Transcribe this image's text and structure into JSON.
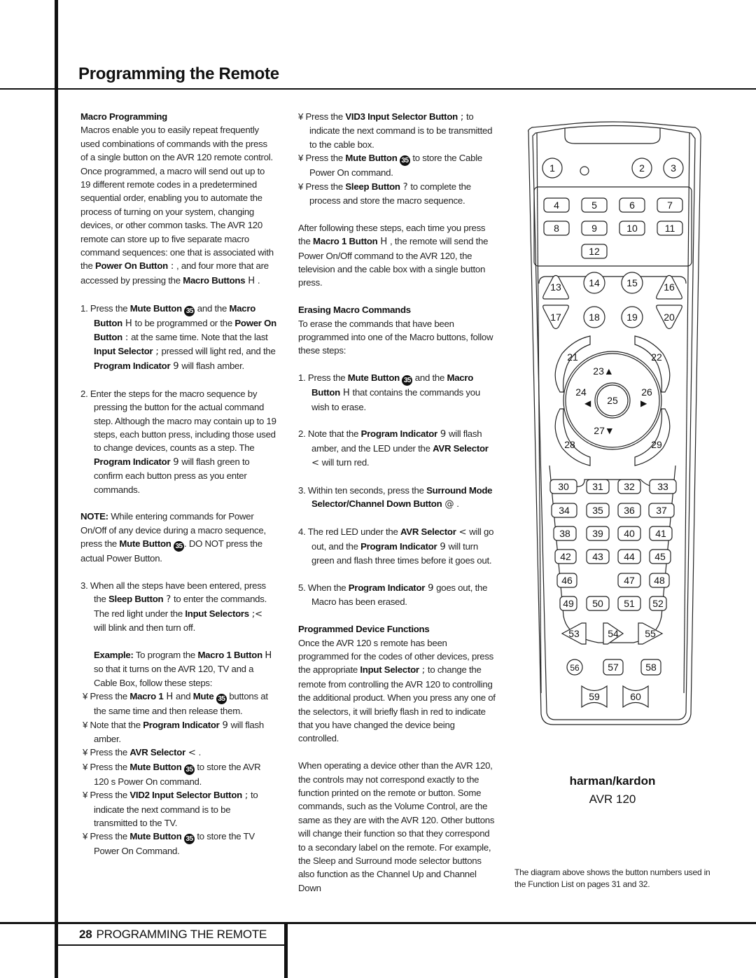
{
  "header": {
    "title": "Programming the Remote"
  },
  "footer": {
    "page_number": "28",
    "section": "PROGRAMMING THE REMOTE"
  },
  "column1": {
    "macro_heading": "Macro Programming",
    "intro_part1": "Macros enable you to easily repeat frequently used combinations of commands with the press of a single button on the AVR 120 remote control. Once programmed, a macro will send out up to 19 different remote codes in a predetermined sequential order, enabling you to automate the process of turning on your system, changing devices, or other common tasks. The AVR 120 remote can store up to five separate macro command sequences: one that is associated with the ",
    "intro_bold1": "Power On Button",
    "intro_sym1": " : ",
    "intro_part2": " , and four more that are accessed by pressing the ",
    "intro_bold2": "Macro Buttons",
    "intro_sym2": " H ",
    "intro_part3": " .",
    "step1": {
      "num": "1.",
      "t1": "Press the ",
      "b1": "Mute Button",
      "c1": "35",
      "t2": " and the ",
      "b2": "Macro Button",
      "s2": " H ",
      "t3": " to be programmed or the ",
      "b3": "Power On Button",
      "s3": " : ",
      "t4": " at the same time. Note that the last ",
      "b4": "Input Selector",
      "s4": " ; ",
      "t5": " pressed will light red, and the ",
      "b5": "Program Indicator",
      "s5": " 9 ",
      "t6": " will flash amber."
    },
    "step2": {
      "num": "2.",
      "t1": "Enter the steps for the macro sequence by pressing the button for the actual command step. Although the macro may contain up to 19 steps, each button press, including those used to change devices, counts as a step. The ",
      "b1": "Program Indicator",
      "s1": " 9 ",
      "t2": " will flash green to confirm each button press as you enter commands."
    },
    "note": {
      "label": "NOTE:",
      "t1": " While entering commands for Power On/Off of any device during a macro sequence, press the ",
      "b1": "Mute Button",
      "c1": "35",
      "t2": ". DO NOT press the actual Power Button."
    },
    "step3": {
      "num": "3.",
      "t1": "When all the steps have been entered, press the ",
      "b1": "Sleep Button",
      "s1": " ? ",
      "t2": " to enter the commands. The red light under the ",
      "b2": "Input Selectors",
      "s2": " ;< ",
      "t3": " will blink and then turn off."
    },
    "example": {
      "label": "Example:",
      "t1": " To program the ",
      "b1": "Macro 1 Button",
      "s1": "H ",
      "t2": " so that it turns on the AVR 120, TV and a Cable Box, follow these steps:"
    },
    "bullets": [
      {
        "mark": "¥",
        "t1": "Press the ",
        "b1": "Macro 1",
        "s1": " H ",
        "t2": " and ",
        "b2": "Mute",
        "c1": "35",
        "t3": " buttons at the same time and then release them."
      },
      {
        "mark": "¥",
        "t1": "Note that the ",
        "b1": "Program Indicator",
        "s1": " 9 ",
        "t2": " will flash amber."
      },
      {
        "mark": "¥",
        "t1": "Press the ",
        "b1": "AVR Selector",
        "s1": " < ",
        "t2": " ."
      },
      {
        "mark": "¥",
        "t1": "Press the ",
        "b1": "Mute Button",
        "c1": "35",
        "t2": " to store the AVR 120 s Power On command."
      },
      {
        "mark": "¥",
        "t1": "Press the ",
        "b1": "VID2 Input Selector Button",
        "s1": " ; ",
        "t2": " to indicate the next command is to be transmitted to the TV."
      },
      {
        "mark": "¥",
        "t1": "Press the ",
        "b1": "Mute Button",
        "c1": "35",
        "t2": " to store the TV Power On Command."
      }
    ]
  },
  "column2": {
    "bullets": [
      {
        "mark": "¥",
        "t1": "Press the ",
        "b1": "VID3 Input Selector Button",
        "s1": " ; ",
        "t2": " to indicate the next command is to be transmitted to the cable box."
      },
      {
        "mark": "¥",
        "t1": "Press the ",
        "b1": "Mute Button",
        "c1": "35",
        "t2": " to store the Cable Power On command."
      },
      {
        "mark": "¥",
        "t1": "Press the ",
        "b1": "Sleep Button",
        "s1": " ? ",
        "t2": " to complete the process and store the macro sequence."
      }
    ],
    "after": {
      "t1": "After following these steps, each time you press the ",
      "b1": "Macro 1 Button",
      "s1": " H ",
      "t2": " , the remote will send the Power On/Off command to the AVR 120, the television and the cable box with a single button press."
    },
    "erase_heading": "Erasing Macro Commands",
    "erase_intro": "To erase the commands that have been programmed into one of the Macro buttons, follow these steps:",
    "erase_steps": [
      {
        "num": "1.",
        "t1": "Press the ",
        "b1": "Mute Button",
        "c1": "35",
        "t2": " and the ",
        "b2": "Macro Button",
        "s2": " H ",
        "t3": " that contains the commands you wish to erase."
      },
      {
        "num": "2.",
        "t1": "Note that the ",
        "b1": "Program Indicator",
        "s1": " 9 ",
        "t2": " will flash amber, and the LED under the ",
        "b2": "AVR Selector",
        "s2": " < ",
        "t3": " will turn red."
      },
      {
        "num": "3.",
        "t1": "Within ten seconds, press the ",
        "b1": "Surround Mode Selector/Channel Down Button",
        "s1": " @ ",
        "t2": " ."
      },
      {
        "num": "4.",
        "t1": "The red LED under the ",
        "b1": "AVR Selector",
        "s1": " < ",
        "t2": " will go out, and the ",
        "b2": "Program Indicator",
        "s2": " 9 ",
        "t3": " will turn green and flash three times before it goes out."
      },
      {
        "num": "5.",
        "t1": "When the ",
        "b1": "Program Indicator",
        "s1": " 9 ",
        "t2": " goes out, the Macro has been erased."
      }
    ],
    "device_heading": "Programmed Device Functions",
    "device_p1": {
      "t1": "Once the AVR 120 s remote has been programmed for the codes of other devices, press the appropriate ",
      "b1": "Input Selector",
      "s1": " ; ",
      "t2": " to change the remote from controlling the AVR 120 to controlling the additional product. When you press any one of the selectors, it will briefly flash in red to indicate that you have changed the device being controlled."
    },
    "device_p2": "When operating a device other than the AVR 120, the controls may not correspond exactly to the function printed on the remote or button. Some commands, such as the Volume Control, are the same as they are with the AVR 120. Other buttons will change their function so that they correspond to a secondary label on the remote. For example, the Sleep and Surround mode selector buttons also function as the Channel Up and Channel Down"
  },
  "remote": {
    "brand": "harman/kardon",
    "model": "AVR 120",
    "buttons": [
      "1",
      "2",
      "3",
      "4",
      "5",
      "6",
      "7",
      "8",
      "9",
      "10",
      "11",
      "12",
      "13",
      "14",
      "15",
      "16",
      "17",
      "18",
      "19",
      "20",
      "21",
      "22",
      "23",
      "24",
      "25",
      "26",
      "27",
      "28",
      "29",
      "30",
      "31",
      "32",
      "33",
      "34",
      "35",
      "36",
      "37",
      "38",
      "39",
      "40",
      "41",
      "42",
      "43",
      "44",
      "45",
      "46",
      "47",
      "48",
      "49",
      "50",
      "51",
      "52",
      "53",
      "54",
      "55",
      "56",
      "57",
      "58",
      "59",
      "60"
    ],
    "caption": "The diagram above shows the button numbers used in the Function List on pages 31 and 32."
  }
}
